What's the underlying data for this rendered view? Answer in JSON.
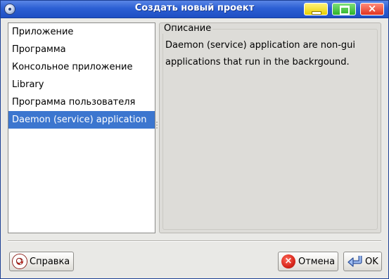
{
  "window": {
    "title": "Создать новый проект",
    "close_glyph": "×"
  },
  "project_types": {
    "items": [
      {
        "label": "Приложение"
      },
      {
        "label": "Программа"
      },
      {
        "label": "Консольное приложение"
      },
      {
        "label": "Library"
      },
      {
        "label": "Программа пользователя"
      },
      {
        "label": "Daemon (service) application"
      }
    ],
    "selected_index": 5
  },
  "description": {
    "legend": "Описание",
    "text": "Daemon (service) application are non-gui applications that run in the backrgound."
  },
  "buttons": {
    "help_label": "Справка",
    "cancel_label": "Отмена",
    "ok_label": "OK"
  },
  "icons": {
    "app": "application-icon",
    "help": "lifebuoy-icon",
    "cancel": "cancel-icon",
    "ok": "enter-arrow-icon"
  },
  "colors": {
    "titlebar": "#2c5fd3",
    "selection": "#3c76cf",
    "dialog_bg": "#e9e9e6"
  }
}
